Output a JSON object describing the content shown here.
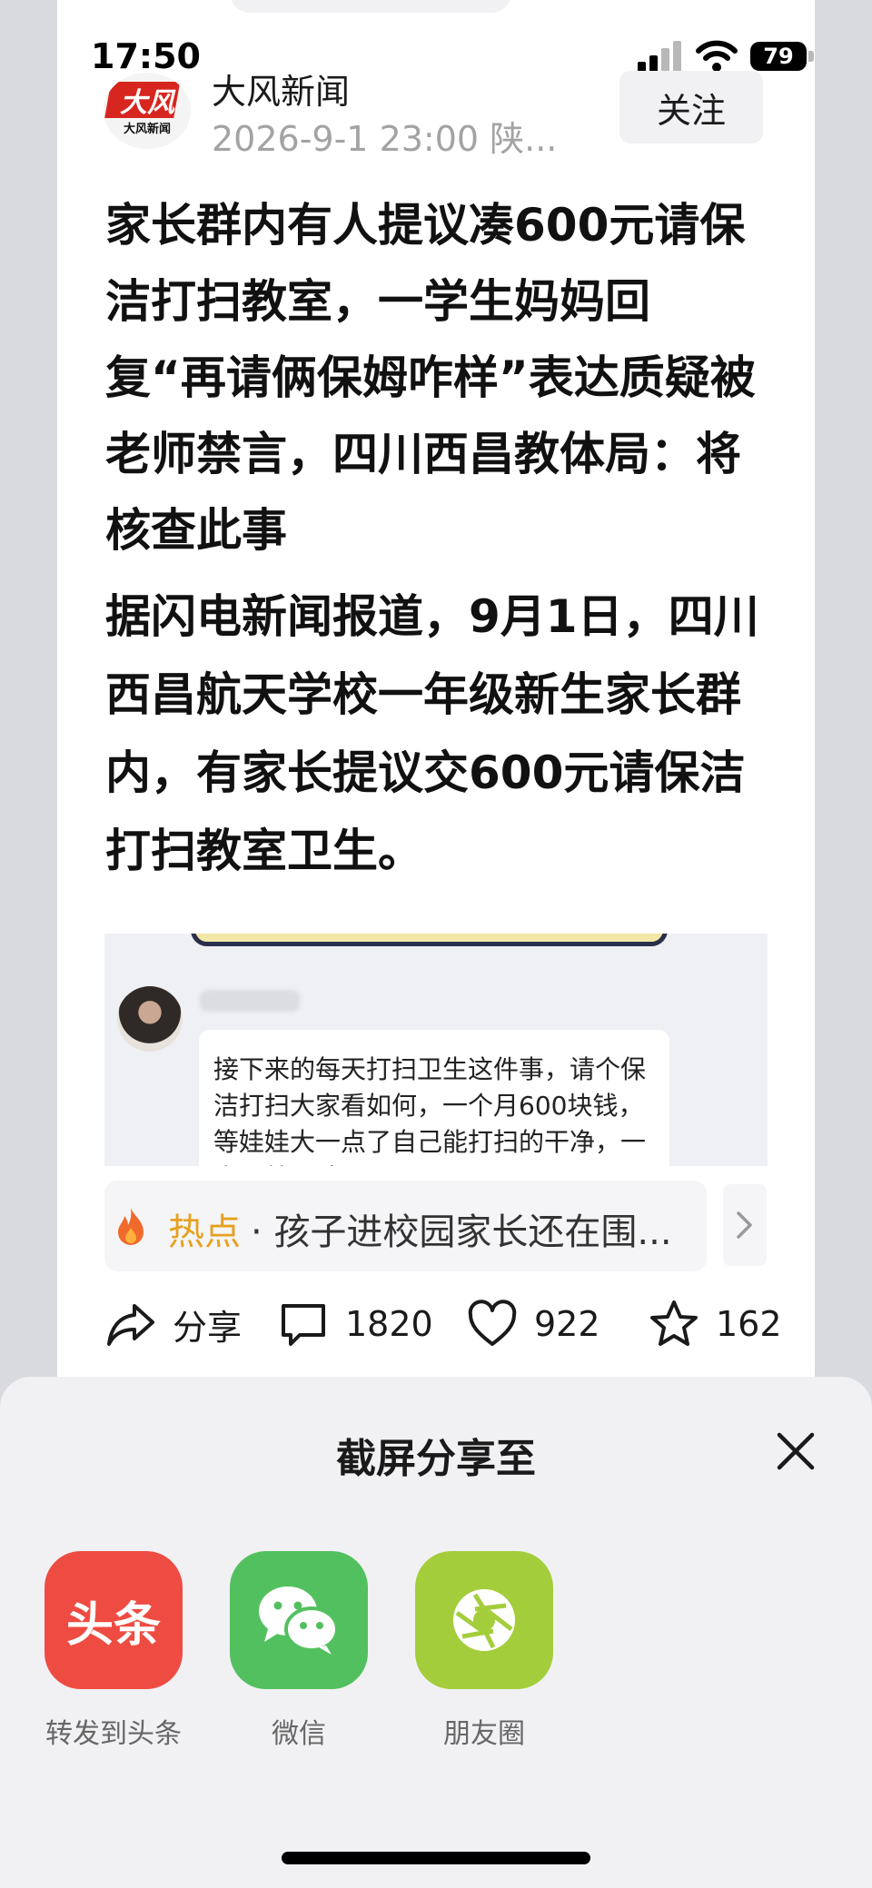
{
  "status_bar": {
    "time": "17:50",
    "battery": "79"
  },
  "header": {
    "source_name": "大风新闻",
    "meta": "2026-9-1 23:00 陕...",
    "follow_label": "关注",
    "logo_text": "大风",
    "logo_subtext": "大风新闻"
  },
  "article": {
    "headline": "家长群内有人提议凑600元请保洁打扫教室，一学生妈妈回复“再请俩保姆咋样”表达质疑被老师禁言，四川西昌教体局：将核查此事",
    "body": "据闪电新闻报道，9月1日，四川西昌航天学校一年级新生家长群内，有家长提议交600元请保洁打扫教室卫生。",
    "embed_text": "接下来的每天打扫卫生这件事，请个保洁打扫大家看如何，一个月600块钱，等娃娃大一点了自己能打扫的干净，一点了就不请了"
  },
  "hot": {
    "label": "热点",
    "separator": "·",
    "text": "孩子进校园家长还在围..."
  },
  "actions": {
    "share_label": "分享",
    "comment_count": "1820",
    "like_count": "922",
    "favorite_count": "162"
  },
  "share_sheet": {
    "title": "截屏分享至",
    "targets": [
      {
        "label": "转发到头条",
        "tile_text": "头条",
        "color": "#ee4c42"
      },
      {
        "label": "微信",
        "color": "#53c05f"
      },
      {
        "label": "朋友圈",
        "color": "#a4cd3c"
      }
    ]
  },
  "colors": {
    "hot_label": "#e6a11f",
    "flame": "#f06a2c"
  }
}
